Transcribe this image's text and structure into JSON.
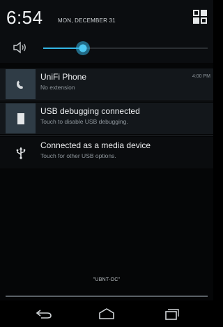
{
  "header": {
    "time": "6:54",
    "date": "MON, DECEMBER 31",
    "quick_settings_icon": "quick-settings-icon"
  },
  "volume": {
    "icon": "speaker-icon",
    "level": 0.24,
    "accent": "#33b5e5"
  },
  "notifications": [
    {
      "icon": "phone-icon",
      "title": "UniFi Phone",
      "subtitle": "No extension",
      "time": "4:00 PM"
    },
    {
      "icon": "usb-debug-icon",
      "title": "USB debugging connected",
      "subtitle": "Touch to disable USB debugging."
    },
    {
      "icon": "usb-icon",
      "title": "Connected as a media device",
      "subtitle": "Touch for other USB options."
    }
  ],
  "carrier": "\"UBNT-OC\"",
  "navbar": {
    "back": "back-icon",
    "home": "home-icon",
    "recents": "recents-icon"
  }
}
